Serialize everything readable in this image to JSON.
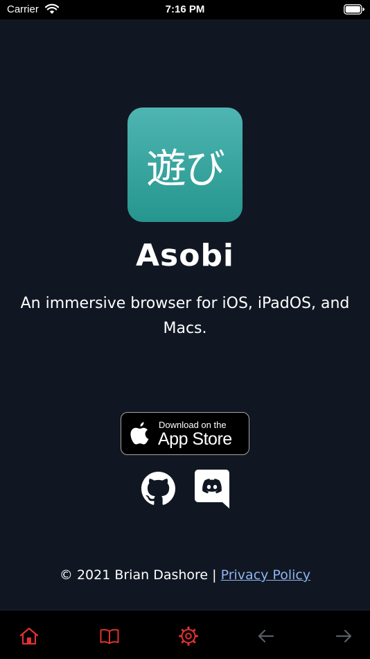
{
  "status_bar": {
    "carrier": "Carrier",
    "time": "7:16 PM"
  },
  "app": {
    "icon_text": "遊び",
    "name": "Asobi",
    "tagline": "An immersive browser for iOS, iPadOS, and Macs."
  },
  "app_store_badge": {
    "small_text": "Download on the",
    "large_text": "App Store"
  },
  "social_icons": [
    "github-icon",
    "discord-icon"
  ],
  "footer": {
    "copyright": "© 2021 Brian Dashore | ",
    "privacy_link": "Privacy Policy"
  },
  "toolbar": {
    "items": [
      "home-icon",
      "book-icon",
      "gear-icon",
      "back-arrow-icon",
      "forward-arrow-icon"
    ],
    "active_color": "#e0322f",
    "disabled_color": "#5a5f66"
  },
  "colors": {
    "background": "#111722",
    "icon_gradient_top": "#4fb5b2",
    "icon_gradient_bottom": "#25968e",
    "link": "#8fb4f2"
  }
}
